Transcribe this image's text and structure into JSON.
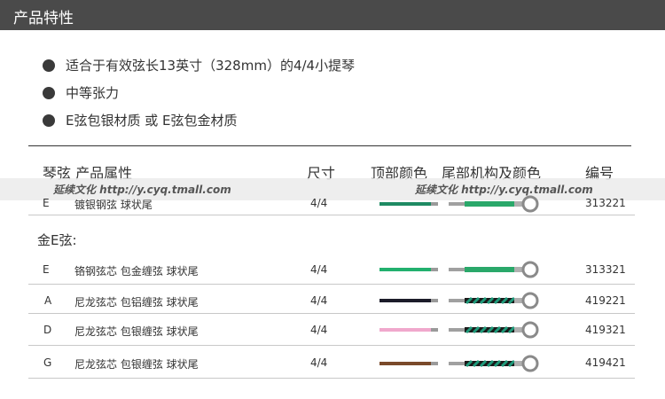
{
  "header": {
    "title": "产品特性"
  },
  "features": [
    "适合于有效弦长13英寸（328mm）的4/4小提琴",
    "中等张力",
    "E弦包银材质 或 E弦包金材质"
  ],
  "table": {
    "headers": {
      "string_attr": "琴弦  产品属性",
      "size": "尺寸",
      "top_color": "顶部颜色",
      "tail_color": "尾部机构及颜色",
      "code": "编号"
    },
    "watermark": "延续文化  http://y.cyq.tmall.com",
    "silver_rows": [
      {
        "string": "E",
        "attr": "镀银钢弦  球状尾",
        "size": "4/4",
        "code": "313221",
        "top_color": "#1e8a63",
        "tail": "green-solid"
      }
    ],
    "gold_section_label": "金E弦:",
    "gold_rows": [
      {
        "string": "E",
        "attr": "铬钢弦芯  包金缠弦  球状尾",
        "size": "4/4",
        "code": "313321",
        "top_color": "#22b06e",
        "tail": "green-solid"
      },
      {
        "string": "A",
        "attr": "尼龙弦芯  包铝缠弦  球状尾",
        "size": "4/4",
        "code": "419221",
        "top_color": "#1c1c2a",
        "tail": "twisted"
      },
      {
        "string": "D",
        "attr": "尼龙弦芯  包银缠弦  球状尾",
        "size": "4/4",
        "code": "419321",
        "top_color": "#f0a8cc",
        "tail": "twisted"
      },
      {
        "string": "G",
        "attr": "尼龙弦芯  包银缠弦  球状尾",
        "size": "4/4",
        "code": "419421",
        "top_color": "#7a4a2a",
        "tail": "twisted"
      }
    ]
  }
}
